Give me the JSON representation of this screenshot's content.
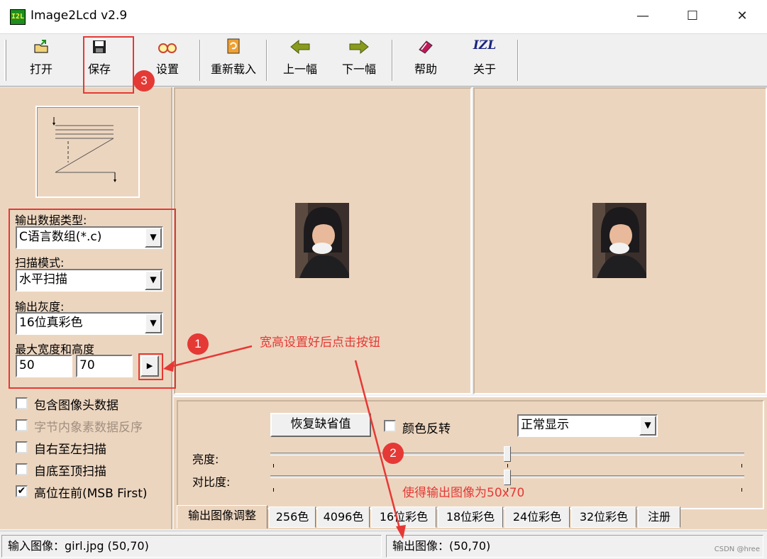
{
  "window": {
    "icon_text": "I2L",
    "title": "Image2Lcd v2.9",
    "controls": {
      "minimize": "—",
      "maximize": "☐",
      "close": "✕"
    }
  },
  "toolbar": {
    "open": "打开",
    "save": "保存",
    "settings": "设置",
    "reload": "重新载入",
    "prev": "上一幅",
    "next": "下一幅",
    "help": "帮助",
    "about": "关于",
    "about_icon": "IZL"
  },
  "left_panel": {
    "output_type_label": "输出数据类型:",
    "output_type_value": "C语言数组(*.c)",
    "scan_mode_label": "扫描模式:",
    "scan_mode_value": "水平扫描",
    "gray_label": "输出灰度:",
    "gray_value": "16位真彩色",
    "size_label": "最大宽度和高度",
    "width_value": "50",
    "height_value": "70",
    "checkboxes": [
      {
        "label": "包含图像头数据",
        "checked": false,
        "disabled": false
      },
      {
        "label": "字节内象素数据反序",
        "checked": false,
        "disabled": true
      },
      {
        "label": "自右至左扫描",
        "checked": false,
        "disabled": false
      },
      {
        "label": "自底至顶扫描",
        "checked": false,
        "disabled": false
      },
      {
        "label": "高位在前(MSB First)",
        "checked": true,
        "disabled": false
      }
    ]
  },
  "adjust": {
    "restore_button": "恢复缺省值",
    "invert_label": "颜色反转",
    "display_value": "正常显示",
    "brightness_label": "亮度:",
    "contrast_label": "对比度:",
    "brightness_level": 0.5,
    "contrast_level": 0.5
  },
  "tabs": [
    "输出图像调整",
    "256色",
    "4096色",
    "16位彩色",
    "18位彩色",
    "24位彩色",
    "32位彩色",
    "注册"
  ],
  "status": {
    "input": "输入图像：girl.jpg (50,70)",
    "output": "输出图像：(50,70)",
    "watermark": "CSDN @hree"
  },
  "annotations": {
    "badge1": "1",
    "badge2": "2",
    "badge3": "3",
    "note1": "宽高设置好后点击按钮",
    "note2": "使得输出图像为50x70"
  },
  "colors": {
    "panel_bg": "#ecd5bf",
    "annotation": "#e53935",
    "icon_green": "#1e8f1e"
  }
}
